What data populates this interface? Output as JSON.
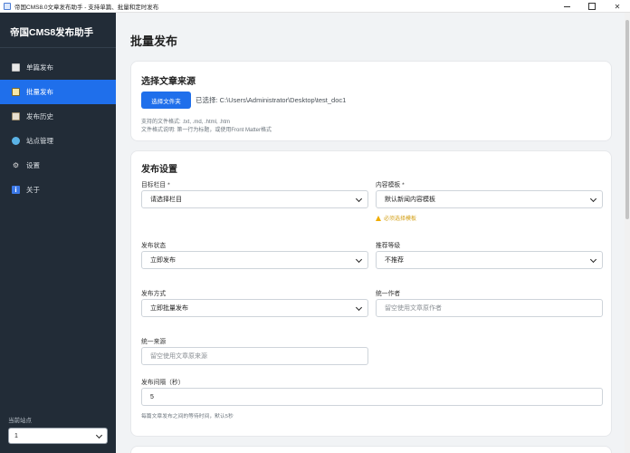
{
  "window": {
    "title": "帝国CMS8.0文章发布助手 - 支持单篇、批量和定时发布"
  },
  "sidebar": {
    "brand": "帝国CMS8发布助手",
    "items": [
      {
        "label": "单篇发布",
        "icon": "document-icon"
      },
      {
        "label": "批量发布",
        "icon": "layers-icon"
      },
      {
        "label": "发布历史",
        "icon": "clipboard-icon"
      },
      {
        "label": "站点管理",
        "icon": "globe-icon"
      },
      {
        "label": "设置",
        "icon": "gear-icon"
      },
      {
        "label": "关于",
        "icon": "info-icon"
      }
    ],
    "active_index": 1,
    "site_label": "当前站点",
    "site_value": "1"
  },
  "main": {
    "page_title": "批量发布",
    "source": {
      "heading": "选择文章来源",
      "button": "选择文件夹",
      "selected": "已选择: C:\\Users\\Administrator\\Desktop\\test_doc1",
      "hint1": "支持的文件格式: .txt, .md, .html, .htm",
      "hint2": "文件格式说明: 第一行为标题，或使用Front Matter格式"
    },
    "settings": {
      "heading": "发布设置",
      "column_label": "目标栏目 *",
      "column_value": "请选择栏目",
      "template_label": "内容模板 *",
      "template_value": "默认新闻内容模板",
      "template_warning": "必须选择模板",
      "status_label": "发布状态",
      "status_value": "立即发布",
      "recommend_label": "推荐等级",
      "recommend_value": "不推荐",
      "mode_label": "发布方式",
      "mode_value": "立即批量发布",
      "author_label": "统一作者",
      "author_placeholder": "留空使用文章原作者",
      "source_label": "统一来源",
      "source_placeholder": "留空使用文章原来源",
      "interval_label": "发布间隔（秒）",
      "interval_value": "5",
      "interval_hint": "每篇文章发布之间的等待时间，默认5秒"
    }
  },
  "colors": {
    "accent": "#1f6feb",
    "sidebar_bg": "#222c37",
    "warning": "#f0ad00"
  }
}
